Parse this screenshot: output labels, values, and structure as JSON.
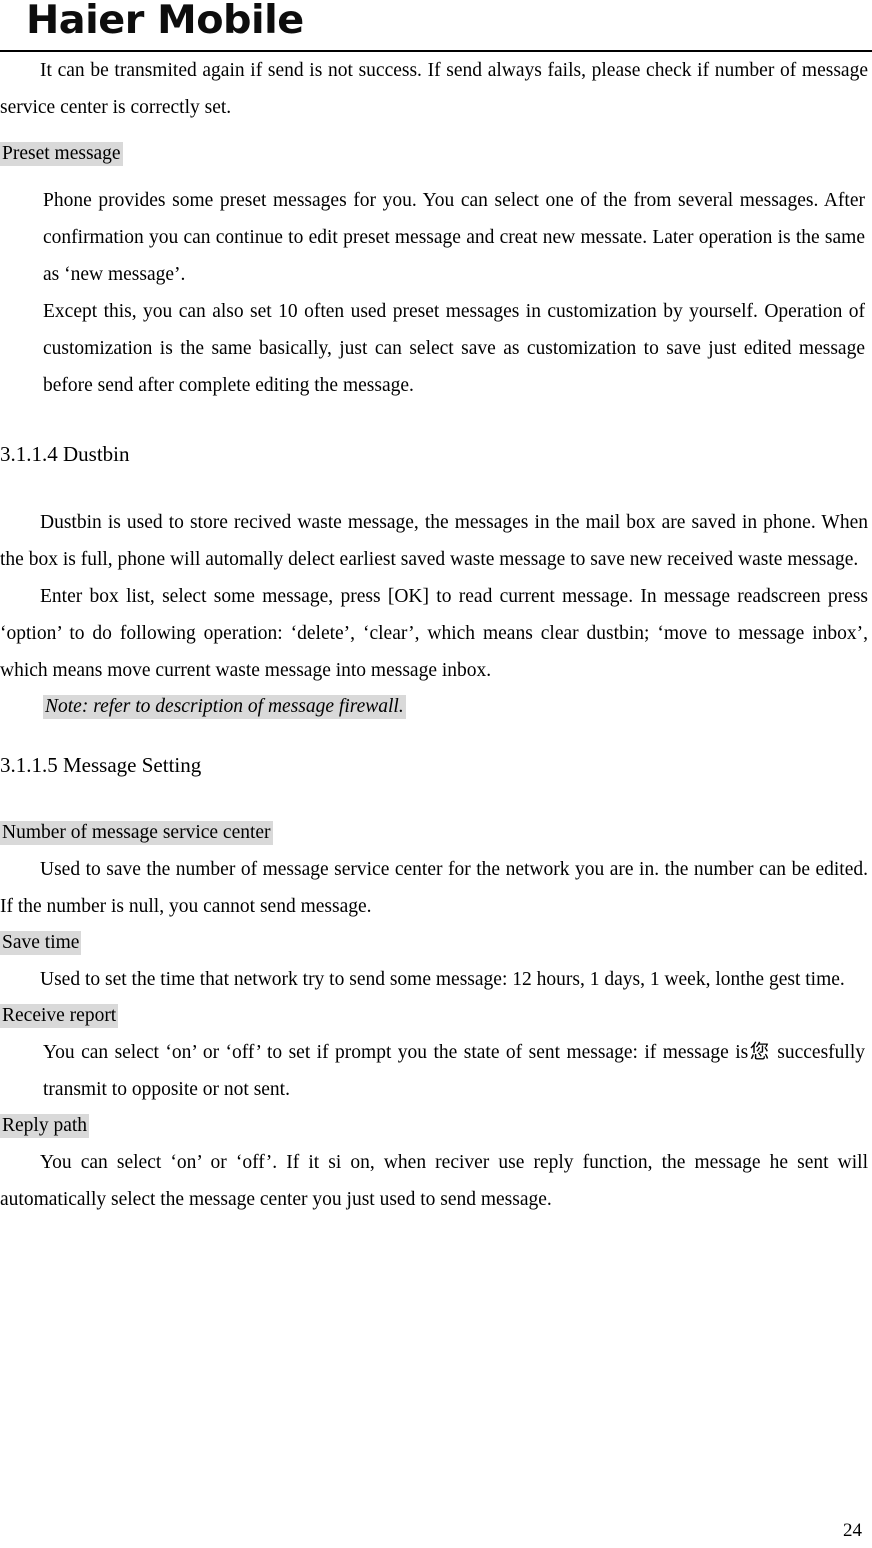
{
  "header": {
    "logo_text": "Haier Mobile"
  },
  "body": {
    "intro_paragraph": "It can be transmited again if send is not success. If send always fails, please check if number of message service center is correctly set.",
    "preset_message_label": "Preset message",
    "preset_paragraph_1": "Phone provides some preset messages for you. You can select one of the from several messages. After confirmation you can continue to edit preset message and creat new messate. Later operation is the same as ‘new message’.",
    "preset_paragraph_2": "Except this, you can also set 10 often used preset messages in customization by yourself. Operation of customization is the same basically, just can select save as customization to save just edited message before send after complete editing the message.",
    "dustbin_heading": "3.1.1.4 Dustbin",
    "dustbin_paragraph_1": "Dustbin is used to store recived waste message, the messages in the mail box are saved in phone. When the box is full, phone will automally delect earliest saved waste message to save new received waste message.",
    "dustbin_paragraph_2": "Enter box list, select some message, press [OK] to read current message. In message readscreen press ‘option’ to do following operation: ‘delete’, ‘clear’, which means clear dustbin; ‘move to message inbox’, which means move current waste message into message inbox.",
    "dustbin_note": "Note: refer to description of message firewall.",
    "message_setting_heading": "3.1.1.5 Message Setting",
    "service_center_label": "Number of message service center",
    "service_center_paragraph": "Used to save the number of message service center for the network you are in. the number can be edited. If the number is null, you cannot send message.",
    "save_time_label": "Save time",
    "save_time_paragraph": "Used to set the time that network try to send some message: 12 hours, 1 days, 1 week, lonthe gest time.",
    "receive_report_label": "Receive report",
    "receive_report_paragraph": "You can select ‘on’ or ‘off’ to set if prompt you the state of sent message: if message is您 succesfully transmit to opposite or not sent.",
    "reply_path_label": "Reply path",
    "reply_path_paragraph": "You can select ‘on’ or ‘off’. If it si on, when reciver use reply function, the message he sent will automatically select the message center you just used to send message."
  },
  "footer": {
    "page_number": "24"
  },
  "colors": {
    "highlight": "#d9d9d9",
    "text": "#000000",
    "rule": "#000000"
  }
}
